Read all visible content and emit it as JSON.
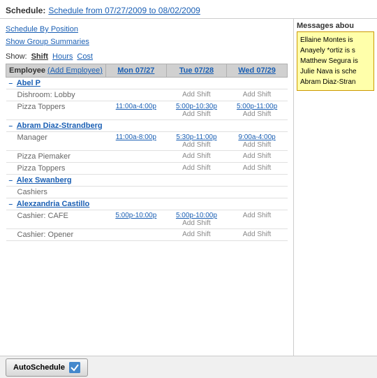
{
  "header": {
    "schedule_label": "Schedule:",
    "schedule_link": "Schedule from 07/27/2009 to 08/02/2009"
  },
  "nav": {
    "by_position": "Schedule By Position",
    "group_summaries": "Show Group Summaries"
  },
  "show": {
    "label": "Show:",
    "shift": "Shift",
    "hours": "Hours",
    "cost": "Cost"
  },
  "messages": {
    "header": "Messages abou",
    "items": [
      "Ellaine Montes is ",
      "Anayely *ortiz is s",
      "Matthew Segura is",
      "Julie Nava is sche",
      "Abram Diaz-Stran"
    ]
  },
  "table": {
    "col_employee": "Employee",
    "col_add_employee": "Add Employee",
    "col_mon": "Mon 07/27",
    "col_tue": "Tue 07/28",
    "col_wed": "Wed 07/29",
    "employees": [
      {
        "name": "Abel P",
        "positions": [
          {
            "name": "Dishroom: Lobby",
            "shifts": {
              "mon": "",
              "tue": "Add Shift",
              "wed": "Add Shift"
            }
          },
          {
            "name": "Pizza Toppers",
            "shifts": {
              "mon": "11:00a-4:00p",
              "tue": "5:00p-10:30p",
              "wed": "5:00p-11:00p",
              "tue_add": "Add Shift",
              "wed_add": "Add Shift"
            }
          }
        ]
      },
      {
        "name": "Abram Diaz-Strandberg",
        "positions": [
          {
            "name": "Manager",
            "shifts": {
              "mon": "11:00a-8:00p",
              "tue": "5:30p-11:00p",
              "wed": "9:00a-4:00p",
              "tue_add": "Add Shift",
              "wed_add": "Add Shift"
            }
          },
          {
            "name": "Pizza Piemaker",
            "shifts": {
              "mon": "",
              "tue": "Add Shift",
              "wed": "Add Shift"
            }
          },
          {
            "name": "Pizza Toppers",
            "shifts": {
              "mon": "",
              "tue": "Add Shift",
              "wed": "Add Shift"
            }
          }
        ]
      },
      {
        "name": "Alex Swanberg",
        "positions": [
          {
            "name": "Cashiers",
            "shifts": {
              "mon": "",
              "tue": "",
              "wed": ""
            }
          }
        ]
      },
      {
        "name": "Alexzandria Castillo",
        "positions": [
          {
            "name": "Cashier: CAFE",
            "shifts": {
              "mon": "5:00p-10:00p",
              "tue": "5:00p-10:00p",
              "wed": "Add Shift",
              "tue_add": "Add Shift"
            }
          },
          {
            "name": "Cashier: Opener",
            "shifts": {
              "mon": "",
              "tue": "Add Shift",
              "wed": "Add Shift"
            }
          }
        ]
      }
    ]
  },
  "autoschedule": {
    "button_label": "AutoSchedule"
  }
}
